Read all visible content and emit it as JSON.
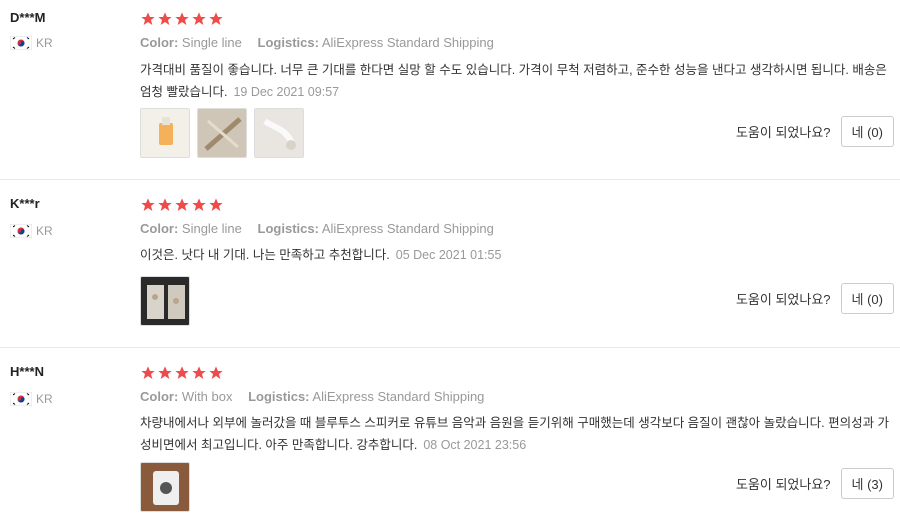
{
  "labels": {
    "color": "Color:",
    "logistics": "Logistics:",
    "helpful_question": "도움이 되었나요?"
  },
  "reviews": [
    {
      "user": "D***M",
      "country": "KR",
      "rating": 5,
      "color": "Single line",
      "logistics": "AliExpress Standard Shipping",
      "text": "가격대비 품질이 좋습니다. 너무 큰 기대를 한다면 실망 할 수도 있습니다. 가격이 무척 저렴하고, 준수한 성능을 낸다고 생각하시면 됩니다. 배송은 엄청 빨랐습니다.",
      "date": "19 Dec 2021 09:57",
      "helpful_button": "네 (0)",
      "images": [
        "photo-1",
        "photo-2",
        "photo-3"
      ]
    },
    {
      "user": "K***r",
      "country": "KR",
      "rating": 5,
      "color": "Single line",
      "logistics": "AliExpress Standard Shipping",
      "text": "이것은. 낫다 내 기대. 나는 만족하고 추천합니다.",
      "date": "05 Dec 2021 01:55",
      "helpful_button": "네 (0)",
      "images": [
        "photo-1"
      ]
    },
    {
      "user": "H***N",
      "country": "KR",
      "rating": 5,
      "color": "With box",
      "logistics": "AliExpress Standard Shipping",
      "text": "차량내에서나 외부에 놀러갔을 때 블루투스 스피커로 유튜브 음악과 음원을 듣기위해 구매했는데 생각보다 음질이 괜찮아 놀랐습니다. 편의성과 가성비면에서 최고입니다. 아주 만족합니다. 강추합니다.",
      "date": "08 Oct 2021 23:56",
      "helpful_button": "네 (3)",
      "images": [
        "photo-1"
      ]
    }
  ],
  "colors": {
    "star": "#f04b4b",
    "divider": "#e8e8e8",
    "muted": "#999999"
  }
}
